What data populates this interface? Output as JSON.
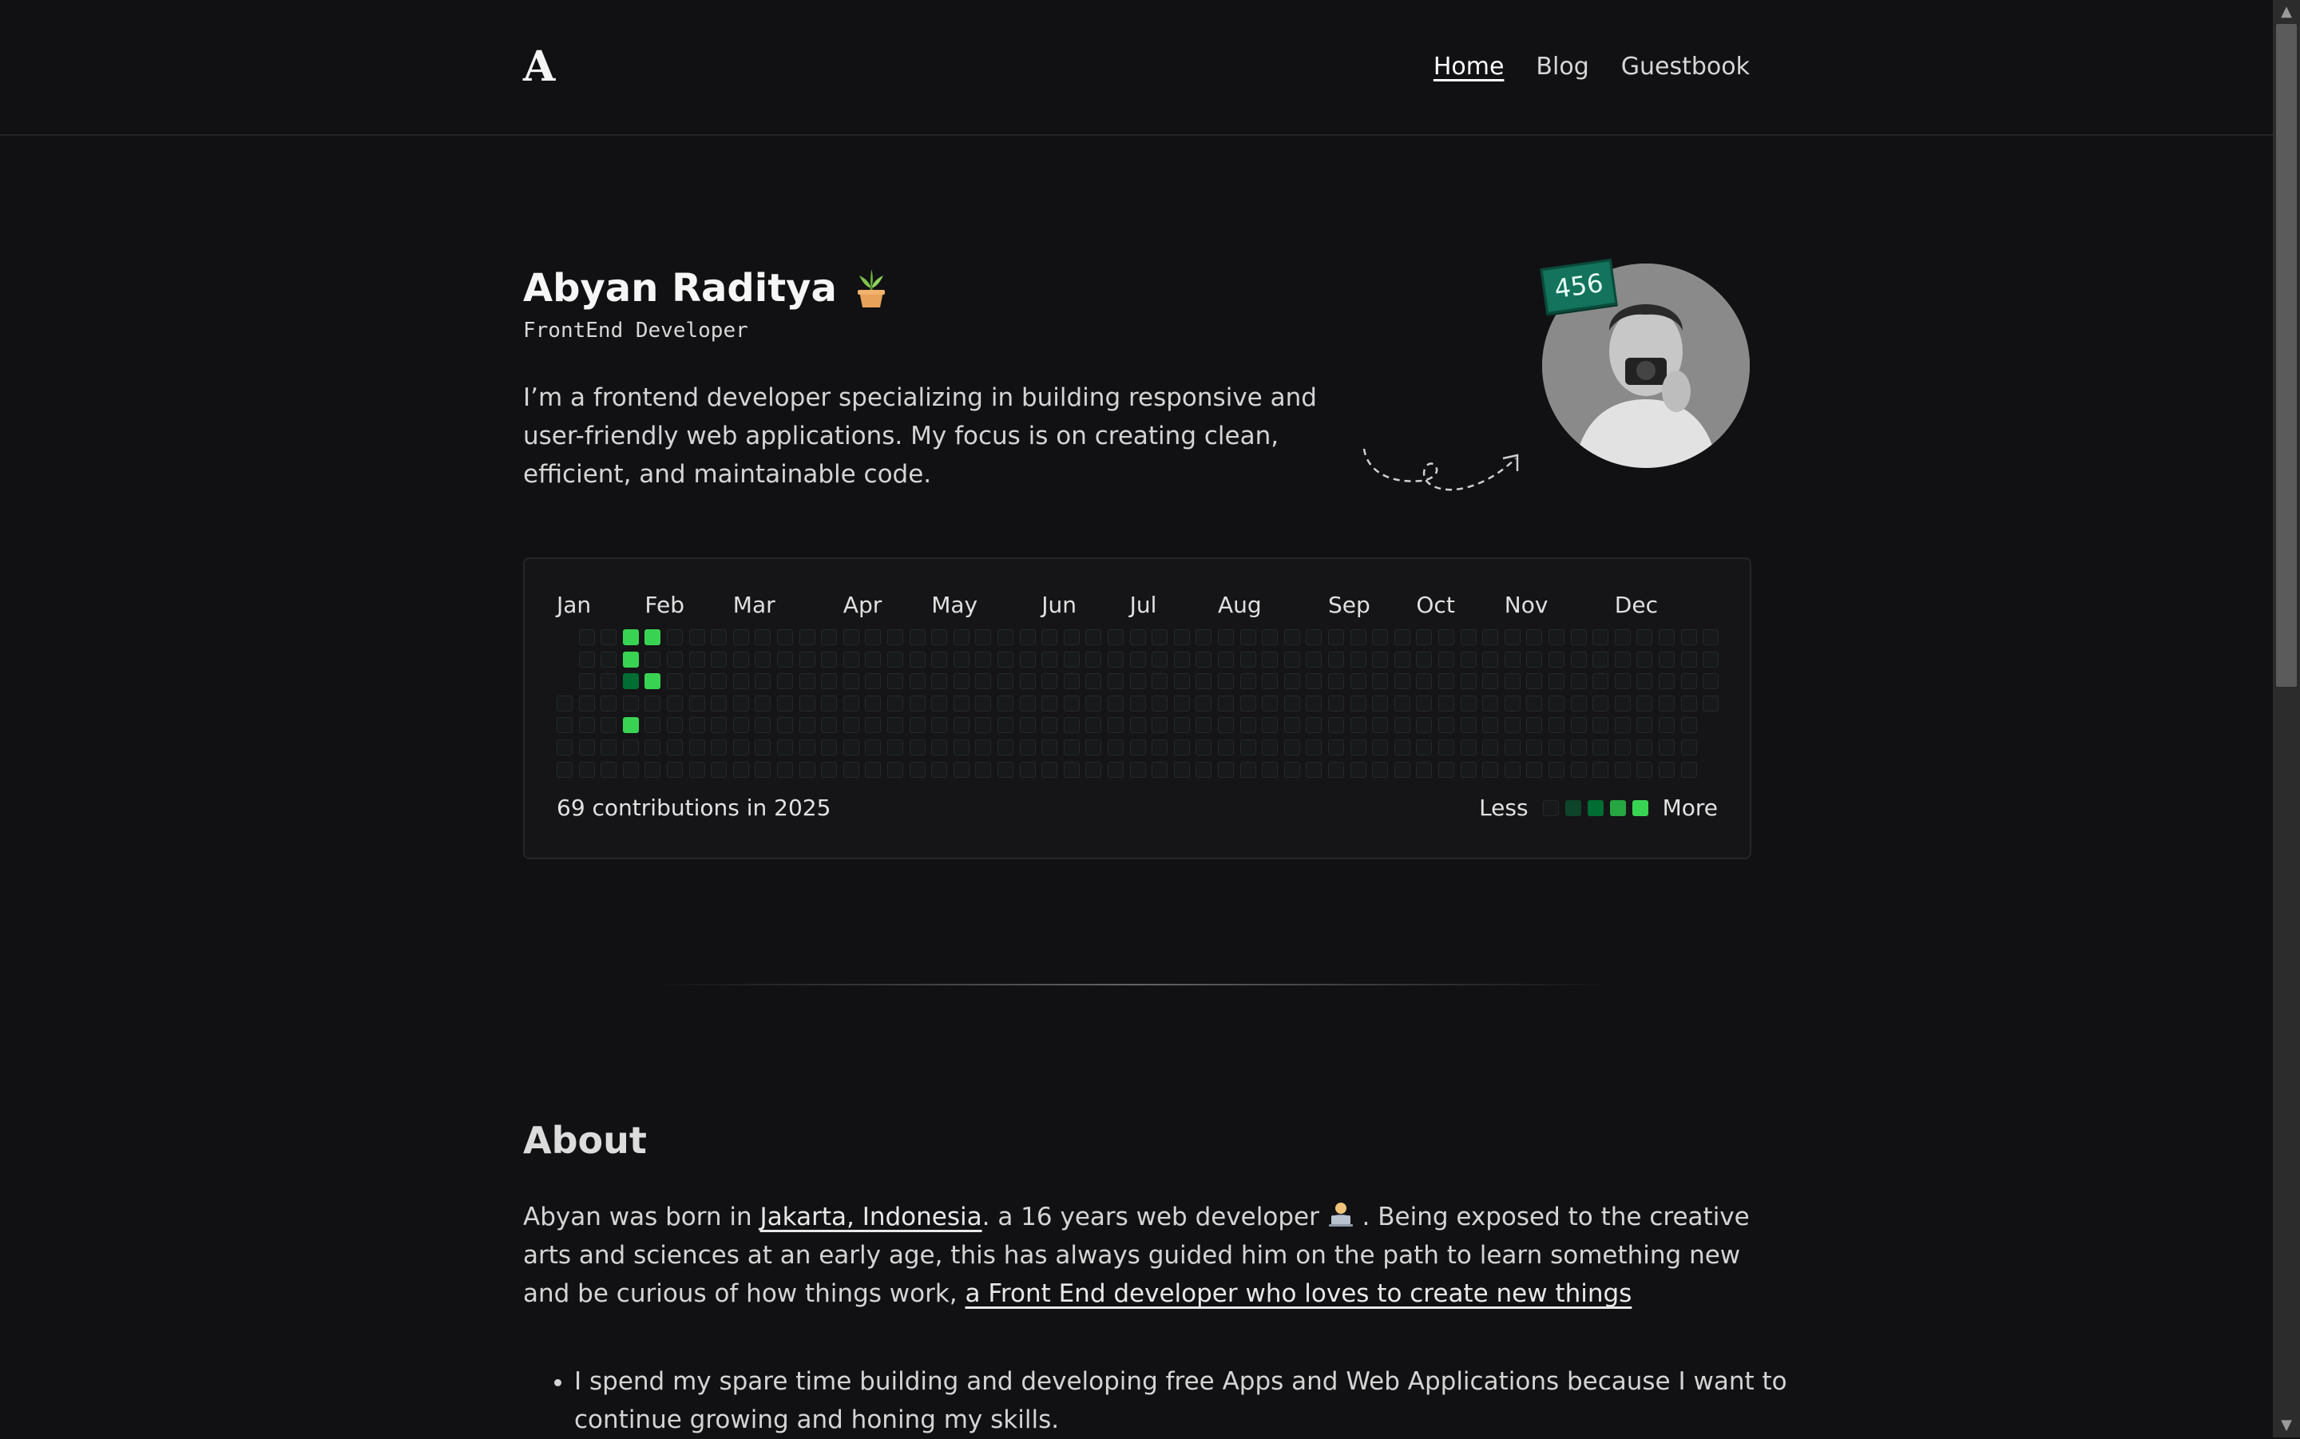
{
  "header": {
    "logo": "A",
    "nav": [
      {
        "label": "Home",
        "active": true
      },
      {
        "label": "Blog",
        "active": false
      },
      {
        "label": "Guestbook",
        "active": false
      }
    ]
  },
  "hero": {
    "name": "Abyan Raditya",
    "role": "FrontEnd Developer",
    "bio": "I’m a frontend developer specializing in building responsive and user-friendly web applications. My focus is on creating clean, efficient, and maintainable code.",
    "badge": "456",
    "icons": [
      "plant-icon",
      "arrow-doodle-icon",
      "avatar-photo"
    ]
  },
  "contributions": {
    "months": [
      "Jan",
      "Feb",
      "Mar",
      "Apr",
      "May",
      "Jun",
      "Jul",
      "Aug",
      "Sep",
      "Oct",
      "Nov",
      "Dec"
    ],
    "total_text": "69 contributions in 2025",
    "legend_less": "Less",
    "legend_more": "More",
    "legend_colors": [
      "#17191b",
      "#0e4429",
      "#006d32",
      "#26a641",
      "#39d353"
    ],
    "active_cells": [
      {
        "week": 3,
        "day": 0,
        "level": 4
      },
      {
        "week": 4,
        "day": 0,
        "level": 4
      },
      {
        "week": 3,
        "day": 1,
        "level": 4
      },
      {
        "week": 3,
        "day": 2,
        "level": 2
      },
      {
        "week": 4,
        "day": 2,
        "level": 4
      },
      {
        "week": 3,
        "day": 4,
        "level": 4
      }
    ]
  },
  "about": {
    "title": "About",
    "text_1": "Abyan was born in ",
    "location_link": "Jakarta, Indonesia",
    "text_2": ". a 16 years web developer ",
    "text_3": " . Being exposed to the creative arts and sciences at an early age, this has always guided him on the path to learn something new and be curious of how things work, ",
    "tagline_link": "a Front End developer who loves to create new things",
    "bullets": [
      "I spend my spare time building and developing free Apps and Web Applications because I want to continue growing and honing my skills."
    ]
  },
  "theme": {
    "background": "#111113",
    "accent_green": "#39d353",
    "badge_green": "#13735c"
  }
}
